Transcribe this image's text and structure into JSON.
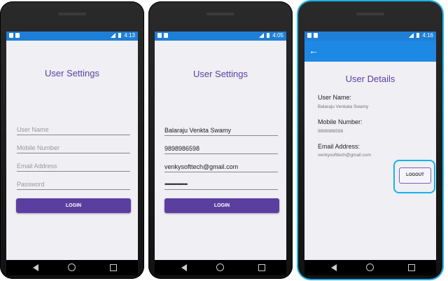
{
  "screens": [
    {
      "time": "4:13",
      "title": "User Settings",
      "fields": [
        "User Name",
        "Mobile Number",
        "Email Address",
        "Password"
      ],
      "button": "LOGIN"
    },
    {
      "time": "4:05",
      "title": "User Settings",
      "values": [
        "Balaraju Venkta Swamy",
        "9898986598",
        "venkysofttech@gmail.com",
        "•••••••••••••••"
      ],
      "button": "LOGIN"
    },
    {
      "time": "4:16",
      "title": "User Details",
      "back_icon": "←",
      "labels": [
        "User Name:",
        "Mobile Number:",
        "Email Address:"
      ],
      "values": [
        "Balaraju Venkata Swamy",
        "9898986598",
        "venkysofttech@gmail.com"
      ],
      "button": "LOGOUT"
    }
  ],
  "colors": {
    "statusbar": "#1f7fd6",
    "appbar": "#1e88e5",
    "accent": "#5b3fa0",
    "highlight": "#1ab3e6"
  }
}
